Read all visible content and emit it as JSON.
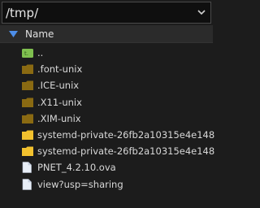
{
  "path_bar": {
    "value": "/tmp/",
    "dropdown_icon": "chevron-down-icon"
  },
  "header": {
    "sort_icon": "sort-descending-triangle-icon",
    "name_label": "Name"
  },
  "files": [
    {
      "name": "..",
      "icon": "parent-folder-icon",
      "color": "#7fbf4f"
    },
    {
      "name": ".font-unix",
      "icon": "folder-dark-icon",
      "color": "#8a6a12"
    },
    {
      "name": ".ICE-unix",
      "icon": "folder-dark-icon",
      "color": "#8a6a12"
    },
    {
      "name": ".X11-unix",
      "icon": "folder-dark-icon",
      "color": "#8a6a12"
    },
    {
      "name": ".XIM-unix",
      "icon": "folder-dark-icon",
      "color": "#8a6a12"
    },
    {
      "name": "systemd-private-26fb2a10315e4e148",
      "icon": "folder-icon",
      "color": "#f2c12e"
    },
    {
      "name": "systemd-private-26fb2a10315e4e148",
      "icon": "folder-icon",
      "color": "#f2c12e"
    },
    {
      "name": "PNET_4.2.10.ova",
      "icon": "file-icon",
      "color": "#e8eef7"
    },
    {
      "name": "view?usp=sharing",
      "icon": "file-icon",
      "color": "#e8eef7"
    }
  ],
  "colors": {
    "background": "#1c1c1c",
    "header_bg": "#2b2b2b",
    "accent_blue": "#4d8ee8"
  }
}
